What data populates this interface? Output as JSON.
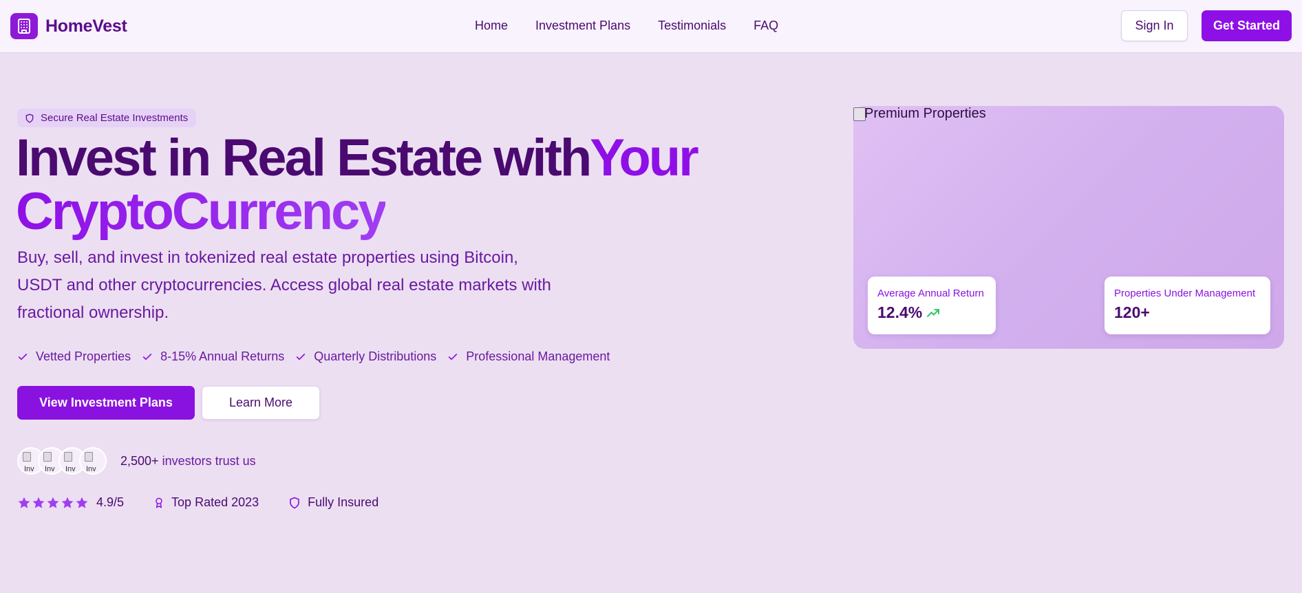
{
  "brand": {
    "name": "HomeVest",
    "logo_icon": "building-icon",
    "accent": "#8e10e6"
  },
  "nav": {
    "items": [
      "Home",
      "Investment Plans",
      "Testimonials",
      "FAQ"
    ]
  },
  "header_buttons": {
    "sign_in": "Sign In",
    "get_started": "Get Started"
  },
  "hero": {
    "badge": "Secure Real Estate Investments",
    "headline": {
      "part1": "Invest in Real Estate with",
      "highlight1": "Your",
      "highlight2": "CryptoCurrency"
    },
    "subtext": "Buy, sell, and invest in tokenized real estate properties using Bitcoin, USDT and other cryptocurrencies. Access global real estate markets with fractional ownership.",
    "features": [
      "Vetted Properties",
      "8-15% Annual Returns",
      "Quarterly Distributions",
      "Professional Management"
    ],
    "primary_button": "View Investment Plans",
    "secondary_button": "Learn More",
    "avatars": [
      "Inv",
      "Inv",
      "Inv",
      "Inv"
    ],
    "trust": {
      "count": "2,500+",
      "text": "investors trust us"
    },
    "rating": {
      "stars": 5,
      "value": "4.9/5"
    },
    "award": "Top Rated 2023",
    "insured": "Fully Insured"
  },
  "showcase": {
    "image_alt": "Premium Properties",
    "stats": [
      {
        "label": "Average Annual Return",
        "value": "12.4%",
        "icon": "trending-up-icon",
        "icon_color": "#22c55e"
      },
      {
        "label": "Properties Under Management",
        "value": "120+"
      }
    ]
  }
}
